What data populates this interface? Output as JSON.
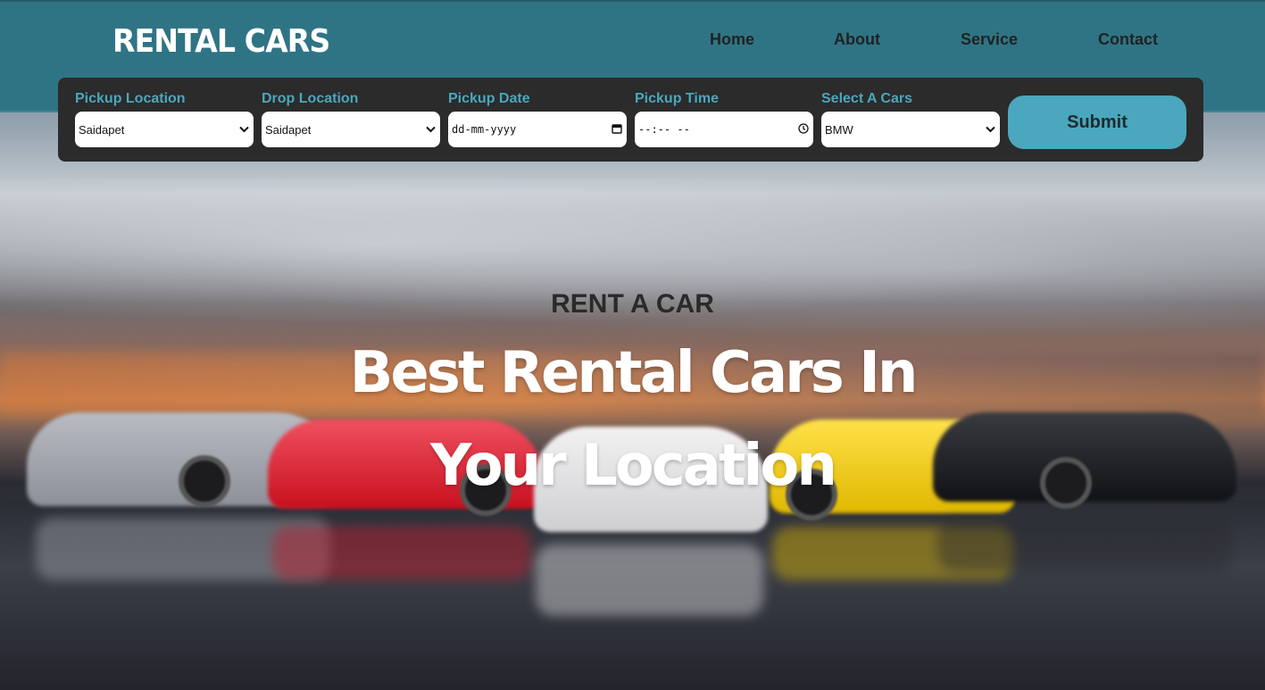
{
  "header": {
    "logo": "RENTAL CARS",
    "nav": [
      "Home",
      "About",
      "Service",
      "Contact"
    ]
  },
  "booking": {
    "pickup_location": {
      "label": "Pickup Location",
      "value": "Saidapet"
    },
    "drop_location": {
      "label": "Drop Location",
      "value": "Saidapet"
    },
    "pickup_date": {
      "label": "Pickup Date",
      "value": "dd-mm-yyyy"
    },
    "pickup_time": {
      "label": "Pickup Time",
      "value": "--:-- --"
    },
    "select_car": {
      "label": "Select A Cars",
      "value": "BMW"
    },
    "submit_label": "Submit"
  },
  "hero": {
    "eyebrow": "RENT A CAR",
    "headline": "Best Rental Cars In Your Location"
  },
  "colors": {
    "header_bg": "#2f7485",
    "accent": "#4aa7bd",
    "booking_bg": "#2b2b2b"
  },
  "icons": {
    "select_arrow": "chevron-down-icon",
    "date": "calendar-icon",
    "time": "clock-icon"
  }
}
